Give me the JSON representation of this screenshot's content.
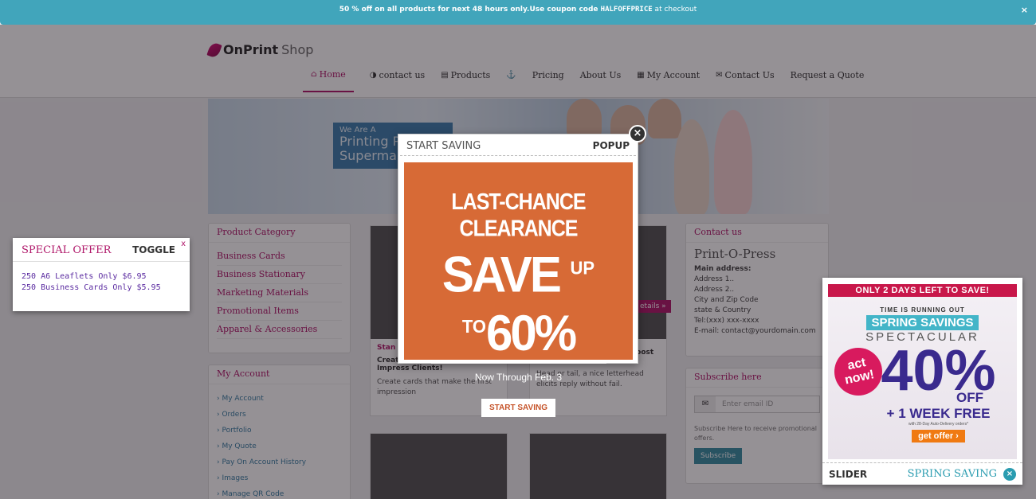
{
  "topbar": {
    "text_a": "50 % off on all products for next 48 hours only.Use coupon code ",
    "coupon": "HALFOFFPRICE",
    "text_b": " at checkout",
    "close": "×"
  },
  "logo": {
    "bold": "OnPrint",
    "light": "Shop"
  },
  "nav": [
    {
      "label": "Home",
      "icon": "home-icon"
    },
    {
      "label": "contact us",
      "icon": "contrast-icon"
    },
    {
      "label": "Products",
      "icon": "list-icon"
    },
    {
      "label": "",
      "icon": "anchor-icon"
    },
    {
      "label": "Pricing",
      "icon": ""
    },
    {
      "label": "About Us",
      "icon": ""
    },
    {
      "label": "My Account",
      "icon": "grid-icon"
    },
    {
      "label": "Contact Us",
      "icon": "envelope-icon"
    },
    {
      "label": "Request a Quote",
      "icon": ""
    }
  ],
  "hero": {
    "line1": "We Are A",
    "line2": "Printing P",
    "line3": "Superma"
  },
  "product_category": {
    "title": "Product Category",
    "items": [
      "Business Cards",
      "Business Stationary",
      "Marketing Materials",
      "Promotional Items",
      "Apparel & Accessories"
    ]
  },
  "my_account": {
    "title": "My Account",
    "items": [
      "My Account",
      "Orders",
      "Portfolio",
      "My Quote",
      "Pay On Account History",
      "Images",
      "Manage QR Code"
    ]
  },
  "products": [
    {
      "category": "Stan",
      "title": "Creative Business Cards to Impress Clients!",
      "desc": "Create cards that make the first impression"
    },
    {
      "category": "",
      "title": "Likeable Letterhead to Boost Business Likelihood!",
      "desc": "Head or tail, a nice letterhead elicits reply without fail."
    }
  ],
  "details_label": "etails »",
  "contact": {
    "title": "Contact us",
    "name": "Print-O-Press",
    "main_label": "Main address:",
    "lines": [
      "Address 1..",
      "Address 2..",
      "City and Zip Code",
      "state & Country",
      "Tel:(xxx) xxx-xxxx",
      "E-mail: contact@yourdomain.com"
    ]
  },
  "subscribe": {
    "title": "Subscribe here",
    "placeholder": "Enter email ID",
    "note": "Subscribe Here to receive promotional offers.",
    "button": "Subscribe"
  },
  "popup": {
    "left_label": "START SAVING",
    "right_label": "POPUP",
    "close": "×",
    "headline": "LAST-CHANCE CLEARANCE",
    "save": "SAVE",
    "up_to": "UP TO",
    "percent": "60%",
    "through": "Now Through Feb. 3",
    "button": "START SAVING"
  },
  "toggle": {
    "left_label": "SPECIAL OFFER",
    "right_label": "TOGGLE",
    "close": "x",
    "offers": [
      "250 A6 Leaflets Only $6.95",
      "250 Business Cards Only $5.95"
    ]
  },
  "slider": {
    "band": "ONLY 2 DAYS LEFT TO SAVE!",
    "running": "TIME IS RUNNING OUT",
    "spring": "SPRING SAVINGS",
    "spectacular": "SPECTACULAR",
    "badge1": "act",
    "badge2": "now!",
    "percent": "40%",
    "off": "OFF",
    "week": "+ 1 WEEK FREE",
    "fine": "with 28-Day Auto-Delivery orders*",
    "button": "get offer ›",
    "left_label": "SLIDER",
    "right_label": "SPRING SAVING",
    "close": "×"
  }
}
